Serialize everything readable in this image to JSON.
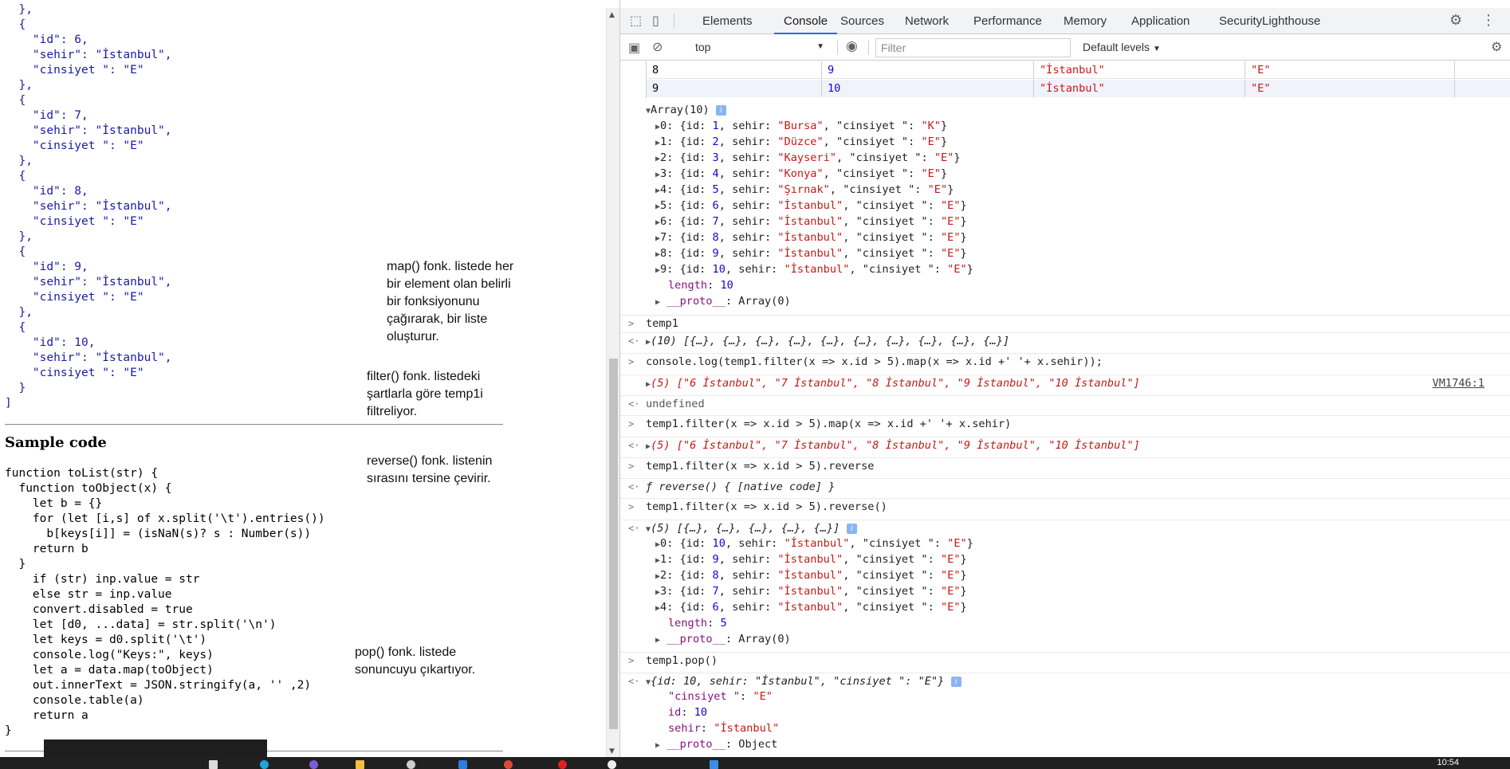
{
  "page": {
    "json_output": "  },\n  {\n    \"id\": 6,\n    \"sehir\": \"İstanbul\",\n    \"cinsiyet \": \"E\"\n  },\n  {\n    \"id\": 7,\n    \"sehir\": \"İstanbul\",\n    \"cinsiyet \": \"E\"\n  },\n  {\n    \"id\": 8,\n    \"sehir\": \"İstanbul\",\n    \"cinsiyet \": \"E\"\n  },\n  {\n    \"id\": 9,\n    \"sehir\": \"İstanbul\",\n    \"cinsiyet \": \"E\"\n  },\n  {\n    \"id\": 10,\n    \"sehir\": \"İstanbul\",\n    \"cinsiyet \": \"E\"\n  }\n]",
    "sample_title": "Sample code",
    "sample_code": "function toList(str) {\n  function toObject(x) {\n    let b = {}\n    for (let [i,s] of x.split('\\t').entries())\n      b[keys[i]] = (isNaN(s)? s : Number(s))\n    return b\n  }\n    if (str) inp.value = str\n    else str = inp.value\n    convert.disabled = true\n    let [d0, ...data] = str.split('\\n')\n    let keys = d0.split('\\t')\n    console.log(\"Keys:\", keys)\n    let a = data.map(toObject)\n    out.innerText = JSON.stringify(a, '' ,2)\n    console.table(a)\n    return a\n}",
    "notes": {
      "map": "map() fonk. listede her bir element olan belirli bir fonksiyonunu çağırarak, bir liste oluşturur.",
      "filter": "filter() fonk. listedeki şartlarla göre temp1i filtreliyor.",
      "reverse": "reverse() fonk. listenin sırasını tersine çevirir.",
      "pop": "pop() fonk. listede sonuncuyu çıkartıyor."
    }
  },
  "devtools": {
    "tabs": [
      "Elements",
      "Console",
      "Sources",
      "Network",
      "Performance",
      "Memory",
      "Application",
      "Security",
      "Lighthouse"
    ],
    "active_tab": "Console",
    "context": "top",
    "filter_placeholder": "Filter",
    "levels": "Default levels",
    "table_rows": [
      {
        "index": "8",
        "id": "9",
        "sehir": "\"İstanbul\"",
        "cinsiyet": "\"E\""
      },
      {
        "index": "9",
        "id": "10",
        "sehir": "\"İstanbul\"",
        "cinsiyet": "\"E\""
      }
    ],
    "array10": {
      "header": "Array(10)",
      "items": [
        {
          "i": "0",
          "id": "1",
          "sehir": "\"Bursa\"",
          "c": "\"K\""
        },
        {
          "i": "1",
          "id": "2",
          "sehir": "\"Düzce\"",
          "c": "\"E\""
        },
        {
          "i": "2",
          "id": "3",
          "sehir": "\"Kayseri\"",
          "c": "\"E\""
        },
        {
          "i": "3",
          "id": "4",
          "sehir": "\"Konya\"",
          "c": "\"E\""
        },
        {
          "i": "4",
          "id": "5",
          "sehir": "\"Şırnak\"",
          "c": "\"E\""
        },
        {
          "i": "5",
          "id": "6",
          "sehir": "\"İstanbul\"",
          "c": "\"E\""
        },
        {
          "i": "6",
          "id": "7",
          "sehir": "\"İstanbul\"",
          "c": "\"E\""
        },
        {
          "i": "7",
          "id": "8",
          "sehir": "\"İstanbul\"",
          "c": "\"E\""
        },
        {
          "i": "8",
          "id": "9",
          "sehir": "\"İstanbul\"",
          "c": "\"E\""
        },
        {
          "i": "9",
          "id": "10",
          "sehir": "\"İstanbul\"",
          "c": "\"E\""
        }
      ],
      "length": "10",
      "proto": "Array(0)"
    },
    "cmd_temp1": "temp1",
    "res_temp1": "(10) [{…}, {…}, {…}, {…}, {…}, {…}, {…}, {…}, {…}, {…}]",
    "cmd_log": "console.log(temp1.filter(x => x.id > 5).map(x => x.id +' '+ x.sehir));",
    "res_log": "(5) [\"6 İstanbul\", \"7 İstanbul\", \"8 İstanbul\", \"9 İstanbul\", \"10 İstanbul\"]",
    "res_log_src": "VM1746:1",
    "res_undefined": "undefined",
    "cmd_map": "temp1.filter(x => x.id > 5).map(x => x.id +' '+ x.sehir)",
    "res_map": "(5) [\"6 İstanbul\", \"7 İstanbul\", \"8 İstanbul\", \"9 İstanbul\", \"10 İstanbul\"]",
    "cmd_rev_ref": "temp1.filter(x => x.id > 5).reverse",
    "res_rev_ref": "ƒ reverse() { [native code] }",
    "cmd_rev": "temp1.filter(x => x.id > 5).reverse()",
    "res_rev_header": "(5) [{…}, {…}, {…}, {…}, {…}]",
    "rev_items": [
      {
        "i": "0",
        "id": "10",
        "sehir": "\"İstanbul\"",
        "c": "\"E\""
      },
      {
        "i": "1",
        "id": "9",
        "sehir": "\"İstanbul\"",
        "c": "\"E\""
      },
      {
        "i": "2",
        "id": "8",
        "sehir": "\"İstanbul\"",
        "c": "\"E\""
      },
      {
        "i": "3",
        "id": "7",
        "sehir": "\"İstanbul\"",
        "c": "\"E\""
      },
      {
        "i": "4",
        "id": "6",
        "sehir": "\"İstanbul\"",
        "c": "\"E\""
      }
    ],
    "rev_length": "5",
    "rev_proto": "Array(0)",
    "cmd_pop": "temp1.pop()",
    "res_pop_header": "{id: 10, sehir: \"İstanbul\", \"cinsiyet \": \"E\"}",
    "pop_props": {
      "cinsiyet": "\"E\"",
      "id": "10",
      "sehir": "\"İstanbul\"",
      "proto": "Object"
    }
  },
  "taskbar": {
    "clock": "10:54"
  }
}
